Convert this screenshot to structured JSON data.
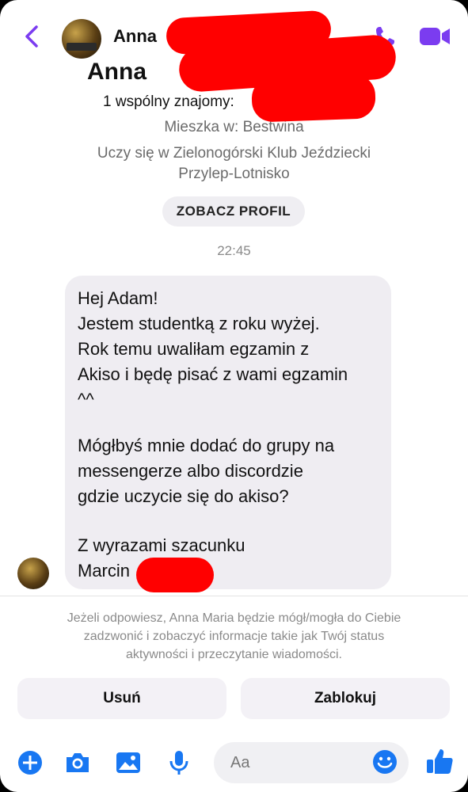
{
  "colors": {
    "accent": "#7b3cf0",
    "messenger_blue": "#1877f2",
    "redaction": "#ff0000"
  },
  "header": {
    "back_icon": "chevron-left-icon",
    "contact_name_visible": "Anna",
    "call_icon": "phone-icon",
    "video_icon": "video-camera-icon"
  },
  "profile": {
    "name_visible": "Anna",
    "mutual_friends": "1 wspólny znajomy:",
    "lives_in": "Mieszka w: Bestwina",
    "studies_line1": "Uczy się w Zielonogórski Klub Jeździecki",
    "studies_line2": "Przylep-Lotnisko",
    "view_profile_button": "ZOBACZ PROFIL"
  },
  "conversation": {
    "timestamp": "22:45",
    "message_lines": [
      "Hej Adam!",
      "Jestem studentką z roku wyżej.",
      "Rok temu uwaliłam egzamin z",
      "Akiso i będę pisać z wami egzamin",
      "^^",
      "",
      "Mógłbyś mnie dodać do grupy na",
      "messengerze albo discordzie",
      "gdzie uczycie się do akiso?",
      "",
      "Z wyrazami szacunku",
      "Marcin"
    ]
  },
  "request_notice": {
    "line1": "Jeżeli odpowiesz, Anna Maria będzie mógł/mogła do Ciebie",
    "line2": "zadzwonić i zobaczyć informacje takie jak Twój status",
    "line3": "aktywności i przeczytanie wiadomości."
  },
  "actions": {
    "delete_label": "Usuń",
    "block_label": "Zablokuj"
  },
  "composer": {
    "icons": [
      "plus-icon",
      "camera-icon",
      "image-icon",
      "microphone-icon",
      "emoji-icon",
      "like-icon"
    ],
    "placeholder": "Aa"
  }
}
